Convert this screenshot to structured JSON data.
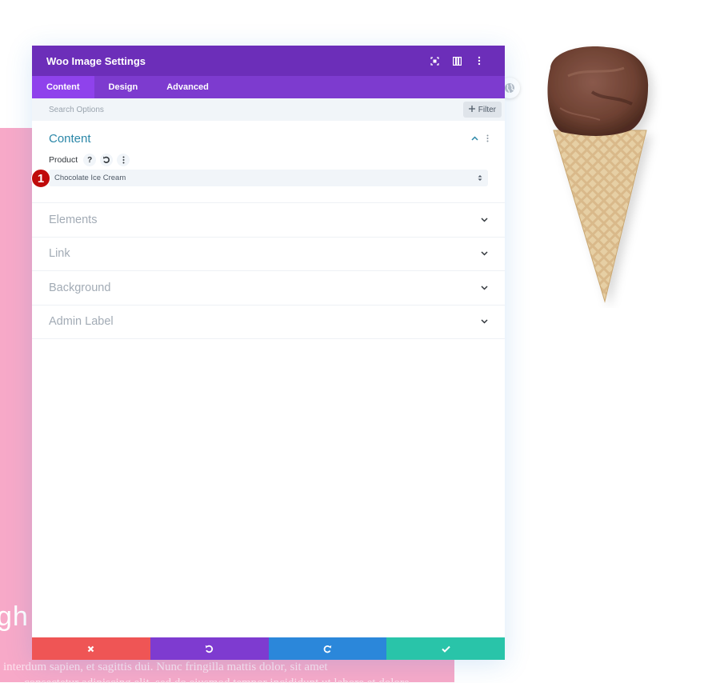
{
  "background": {
    "heading_fragment": "gh",
    "body_line_1": "interdum sapien, et sagittis dui. Nunc fringilla mattis dolor, sit amet",
    "body_line_2": "consectetur adipiscing elit, sed do eiusmod tempor incididunt ut labore et dolore",
    "product_image": "chocolate-ice-cream-cone"
  },
  "panel": {
    "title": "Woo Image Settings",
    "header_icons": [
      "focus-icon",
      "split-view-icon",
      "more-vertical-icon"
    ],
    "tabs": [
      {
        "label": "Content",
        "active": true
      },
      {
        "label": "Design",
        "active": false
      },
      {
        "label": "Advanced",
        "active": false
      }
    ],
    "search": {
      "placeholder": "Search Options",
      "value": ""
    },
    "filter_label": "Filter",
    "sections": {
      "content": {
        "title": "Content",
        "expanded": true,
        "product_field": {
          "label": "Product",
          "help_glyph": "?",
          "selected": "Chocolate Ice Cream",
          "step_badge": "1"
        }
      },
      "collapsed": [
        {
          "title": "Elements"
        },
        {
          "title": "Link"
        },
        {
          "title": "Background"
        },
        {
          "title": "Admin Label"
        }
      ]
    },
    "footer": {
      "buttons": [
        {
          "name": "discard",
          "color": "#ef5555"
        },
        {
          "name": "undo",
          "color": "#7e3bd0"
        },
        {
          "name": "redo",
          "color": "#2b87da"
        },
        {
          "name": "save",
          "color": "#29c4a9"
        }
      ]
    }
  },
  "colors": {
    "header": "#6c2eb9",
    "tabs": "#7d3bcf",
    "tab_active": "#8f42ec",
    "accent_title": "#2b87a8",
    "badge": "#c00b0b",
    "page_pink": "#f7a9c8"
  }
}
